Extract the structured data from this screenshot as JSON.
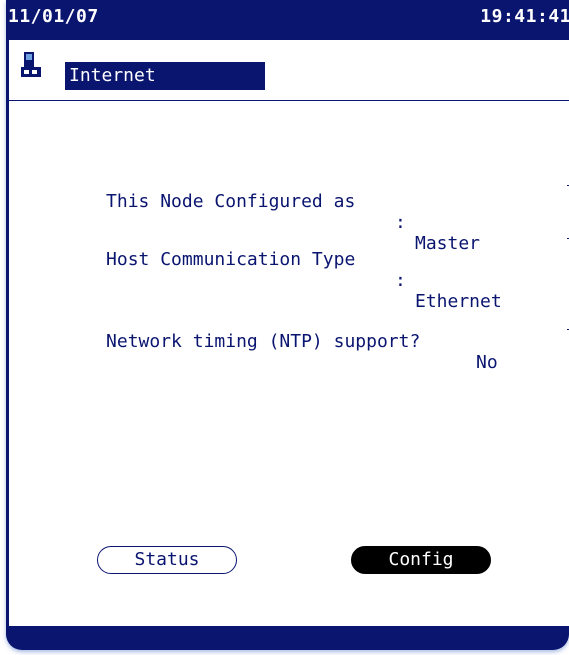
{
  "status_bar": {
    "date": "11/01/07",
    "time": "19:41:41"
  },
  "header": {
    "title": "Internet",
    "icon": "device-node-icon"
  },
  "settings": [
    {
      "label": "This Node Configured as",
      "separator": ":",
      "value": "Master"
    },
    {
      "label": "Host Communication Type",
      "separator": ":",
      "value": "Ethernet"
    },
    {
      "label": "Network timing (NTP) support?",
      "value": "No"
    }
  ],
  "buttons": {
    "status_label": "Status",
    "config_label": "Config"
  },
  "colors": {
    "frame": "#0a1570",
    "text": "#0a1570",
    "active_button": "#000000"
  }
}
